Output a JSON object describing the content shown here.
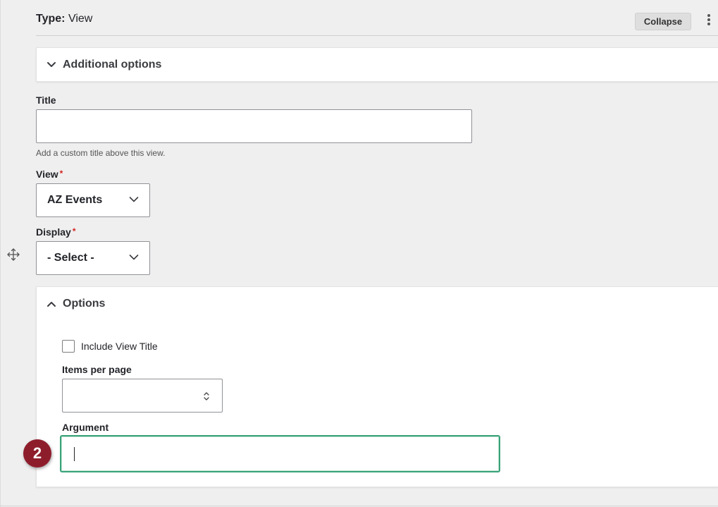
{
  "header": {
    "type_label": "Type:",
    "type_value": "View",
    "collapse_button": "Collapse"
  },
  "additional_options": {
    "summary": "Additional options"
  },
  "title_field": {
    "label": "Title",
    "value": "",
    "description": "Add a custom title above this view."
  },
  "view_field": {
    "label": "View",
    "required_marker": "*",
    "selected": "AZ Events"
  },
  "display_field": {
    "label": "Display",
    "required_marker": "*",
    "selected": "- Select -"
  },
  "options": {
    "summary": "Options",
    "include_view_title": {
      "label": "Include View Title",
      "checked": false
    },
    "items_per_page": {
      "label": "Items per page",
      "value": ""
    },
    "argument": {
      "label": "Argument",
      "value": ""
    }
  },
  "annotation": {
    "step_number": "2",
    "color": "#8e1d2c"
  },
  "colors": {
    "focus_border": "#3aa279",
    "required": "#d72222"
  }
}
